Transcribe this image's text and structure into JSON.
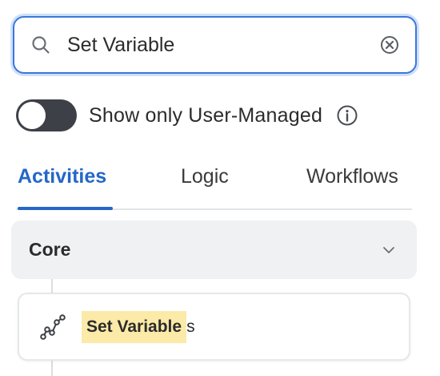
{
  "search": {
    "value": "Set Variable",
    "placeholder": "Search",
    "icon": "search-icon",
    "clear_icon": "clear-icon"
  },
  "filter": {
    "toggle_label": "Show only User-Managed",
    "toggle_on": false,
    "info_icon": "info-icon"
  },
  "tabs": [
    {
      "label": "Activities",
      "active": true
    },
    {
      "label": "Logic",
      "active": false
    },
    {
      "label": "Workflows",
      "active": false
    }
  ],
  "category": {
    "label": "Core",
    "expanded": true,
    "icon": "chevron-down-icon"
  },
  "results": [
    {
      "icon": "variable-icon",
      "match": "Set Variable",
      "rest": "s"
    }
  ],
  "colors": {
    "accent": "#2467c7",
    "focus_ring": "#3b78d8",
    "highlight": "#fbeaa8",
    "toggle_off": "#3d4047",
    "category_bg": "#f0f1f3"
  }
}
